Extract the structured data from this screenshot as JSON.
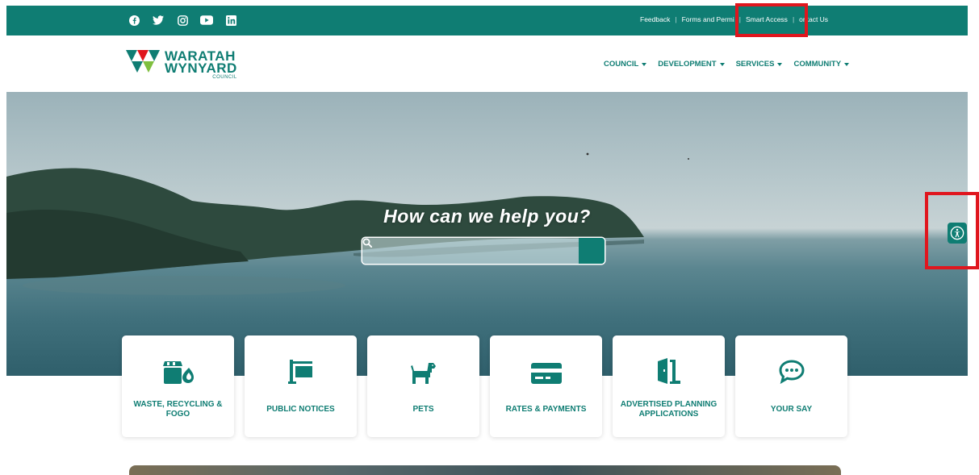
{
  "social": [
    "facebook-icon",
    "twitter-icon",
    "instagram-icon",
    "youtube-icon",
    "linkedin-icon"
  ],
  "topnav": {
    "feedback": "Feedback",
    "forms": "Forms and Permi",
    "smart_access": "Smart Access",
    "contact": "ontact Us"
  },
  "logo": {
    "line1": "WARATAH",
    "line2": "WYNYARD",
    "line3": "COUNCIL"
  },
  "mainnav": [
    {
      "label": "COUNCIL"
    },
    {
      "label": "DEVELOPMENT"
    },
    {
      "label": "SERVICES"
    },
    {
      "label": "COMMUNITY"
    }
  ],
  "hero": {
    "title": "How can we help you?",
    "search_placeholder": ""
  },
  "tiles": [
    {
      "label": "WASTE, RECYCLING & FOGO",
      "icon": "waste-icon"
    },
    {
      "label": "PUBLIC NOTICES",
      "icon": "notice-sign-icon"
    },
    {
      "label": "PETS",
      "icon": "dog-icon"
    },
    {
      "label": "RATES & PAYMENTS",
      "icon": "credit-card-icon"
    },
    {
      "label": "ADVERTISED PLANNING APPLICATIONS",
      "icon": "door-icon"
    },
    {
      "label": "YOUR SAY",
      "icon": "speech-bubble-icon"
    }
  ],
  "colors": {
    "brand": "#0f7d73",
    "highlight": "#e0161e"
  }
}
